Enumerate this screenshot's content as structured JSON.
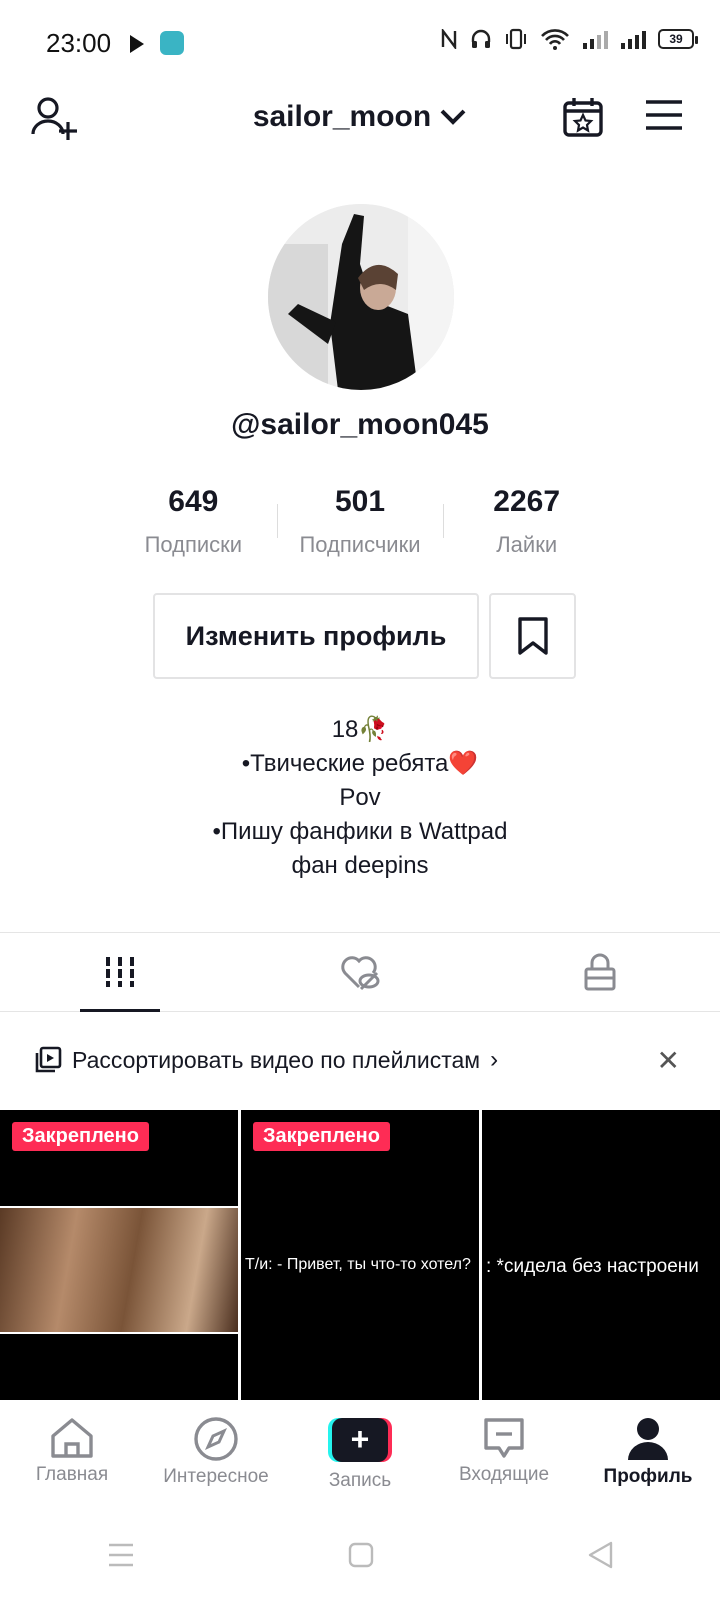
{
  "status_bar": {
    "time": "23:00",
    "battery": "39"
  },
  "header": {
    "username": "sailor_moon"
  },
  "profile": {
    "handle": "@sailor_moon045",
    "stats": [
      {
        "value": "649",
        "label": "Подписки"
      },
      {
        "value": "501",
        "label": "Подписчики"
      },
      {
        "value": "2267",
        "label": "Лайки"
      }
    ],
    "edit_button": "Изменить профиль",
    "bio_lines": [
      "18🥀",
      "•Твические ребята❤️",
      "Pov",
      "•Пишу фанфики в Wattpad",
      "фан deepins"
    ]
  },
  "playlist_banner": {
    "text": "Рассортировать видео по плейлистам"
  },
  "videos": [
    {
      "pinned": "Закреплено",
      "caption": ""
    },
    {
      "pinned": "Закреплено",
      "caption": "Т/и: - Привет, ты что-то хотел?"
    },
    {
      "pinned": "",
      "caption": ": *сидела без настроени"
    }
  ],
  "bottom_nav": [
    {
      "label": "Главная",
      "icon": "home-icon"
    },
    {
      "label": "Интересное",
      "icon": "compass-icon"
    },
    {
      "label": "Запись",
      "icon": "plus-icon"
    },
    {
      "label": "Входящие",
      "icon": "inbox-icon"
    },
    {
      "label": "Профиль",
      "icon": "person-icon"
    }
  ],
  "colors": {
    "accent": "#fe2c55",
    "cyan": "#25f4ee",
    "text": "#161823",
    "muted": "#8a8b91"
  }
}
